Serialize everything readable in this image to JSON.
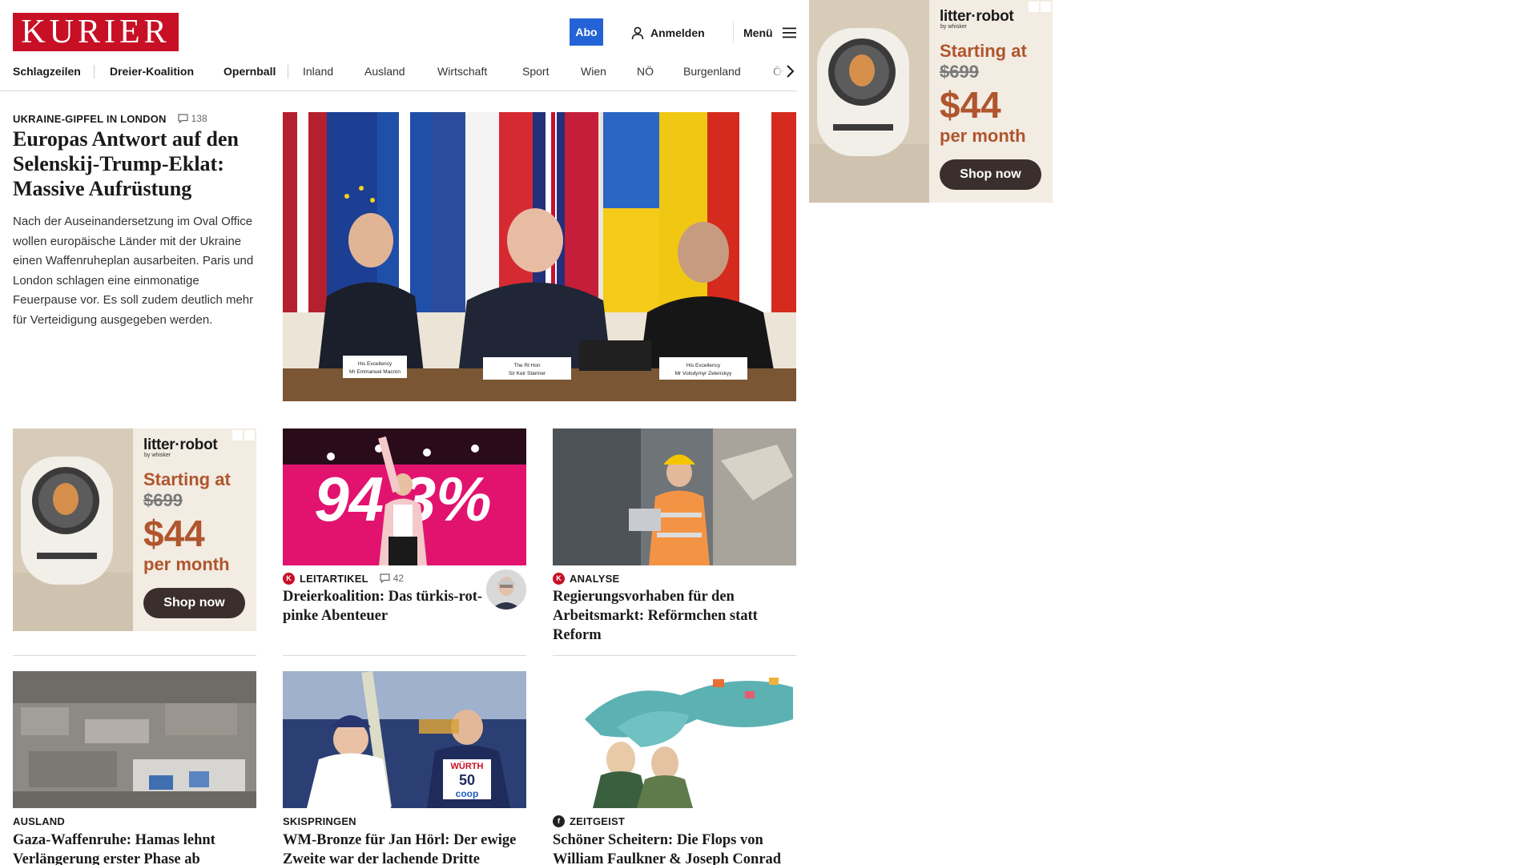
{
  "header": {
    "logo_text": "KURIER",
    "abo_label": "Abo",
    "login_label": "Anmelden",
    "menu_label": "Menü"
  },
  "nav": {
    "items": [
      "Schlagzeilen",
      "Dreier-Koalition",
      "Opernball",
      "Inland",
      "Ausland",
      "Wirtschaft",
      "Sport",
      "Wien",
      "NÖ",
      "Burgenland",
      "Ös"
    ]
  },
  "top_story": {
    "kicker": "UKRAINE-GIPFEL IN LONDON",
    "comments": "138",
    "title": "Europas Antwort auf den Selenskij-Trump-Eklat: Massive Aufrüstung",
    "teaser": "Nach der Auseinandersetzung im Oval Office wollen europäische Länder mit der Ukraine einen Waffenruheplan ausarbeiten. Paris und London schlagen eine einmonatige Feuerpause vor. Es soll zudem deutlich mehr für Verteidigung ausgegeben werden.",
    "placards": [
      [
        "His Excellency",
        "Mr Emmanuel Macron"
      ],
      [
        "The Rt Hon",
        "Sir Keir Starmer"
      ],
      [
        "His Excellency",
        "Mr Volodymyr Zelenskyy"
      ]
    ]
  },
  "ad": {
    "brand": "litter·robot",
    "brand_sub": "by whisker",
    "start": "Starting at",
    "old_price": "$699",
    "price": "$44",
    "per": "per month",
    "cta": "Shop now"
  },
  "cards": [
    {
      "kicker": "LEITARTIKEL",
      "badge": "K",
      "comments": "42",
      "title": "Dreierkoalition: Das türkis-rot-pinke Abenteuer",
      "image_text": "94,3%"
    },
    {
      "kicker": "ANALYSE",
      "badge": "K",
      "title": "Regierungsvorhaben für den Arbeitsmarkt: Reförmchen statt Reform"
    },
    {
      "kicker": "AUSLAND",
      "title": "Gaza-Waffenruhe: Hamas lehnt Verlängerung erster Phase ab"
    },
    {
      "kicker": "SKISPRINGEN",
      "title": "WM-Bronze für Jan Hörl: Der ewige Zweite war der lachende Dritte",
      "bib_number": "50",
      "bib_sponsor": "WÜRTH",
      "bib_brand": "coop"
    },
    {
      "kicker": "ZEITGEIST",
      "badge": "f",
      "title": "Schöner Scheitern: Die Flops von William Faulkner & Joseph Conrad"
    }
  ],
  "colors": {
    "brand_red": "#c70f25",
    "abo_blue": "#2463d6",
    "ad_accent": "#b0552d"
  }
}
